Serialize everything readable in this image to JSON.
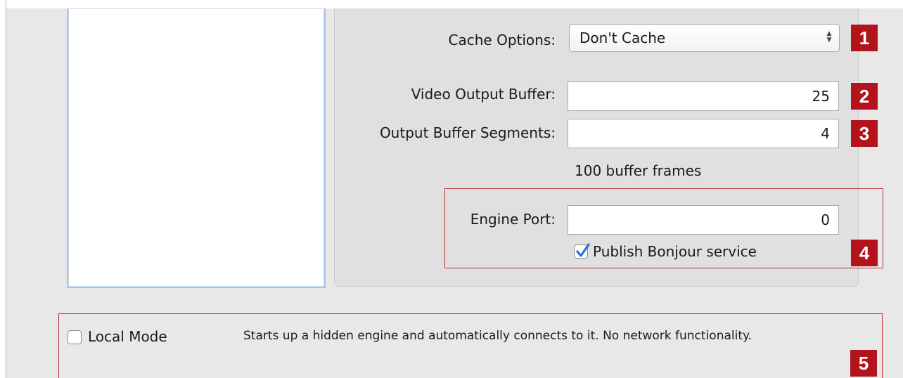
{
  "settings": {
    "cache_options": {
      "label": "Cache Options:",
      "value": "Don't Cache",
      "badge": "1"
    },
    "video_output_buffer": {
      "label": "Video Output Buffer:",
      "value": "25",
      "badge": "2"
    },
    "output_buffer_segments": {
      "label": "Output Buffer Segments:",
      "value": "4",
      "badge": "3"
    },
    "buffer_frames_text": "100 buffer frames",
    "engine_port": {
      "label": "Engine Port:",
      "value": "0"
    },
    "publish_bonjour": {
      "label": "Publish Bonjour service",
      "checked": true
    },
    "engine_badge": "4"
  },
  "local_mode": {
    "label": "Local Mode",
    "checked": false,
    "description": "Starts up a hidden engine and automatically connects to it. No network functionality.",
    "badge": "5"
  },
  "colors": {
    "badge": "#b3141b",
    "highlight_border": "#c0303a",
    "checkmark": "#2a6fd6"
  },
  "icons": {
    "popup_arrows": "up-down-arrows-icon",
    "checkmark": "checkmark-icon"
  }
}
